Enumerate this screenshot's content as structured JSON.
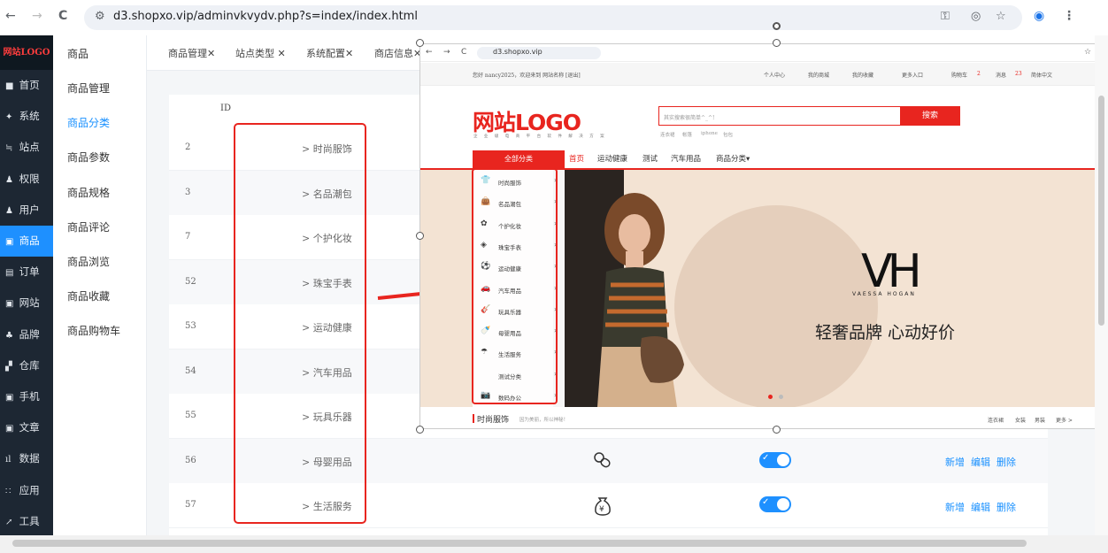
{
  "browser": {
    "url": "d3.shopxo.vip/adminvkvydv.php?s=index/index.html",
    "back_icon": "←",
    "forward_icon": "→",
    "reload_icon": "C"
  },
  "sidebar": {
    "logo": "网站LOGO",
    "items": [
      {
        "icon": "■",
        "label": "首页"
      },
      {
        "icon": "✦",
        "label": "系统"
      },
      {
        "icon": "≒",
        "label": "站点"
      },
      {
        "icon": "♟",
        "label": "权限"
      },
      {
        "icon": "♟",
        "label": "用户"
      },
      {
        "icon": "▣",
        "label": "商品"
      },
      {
        "icon": "▤",
        "label": "订单"
      },
      {
        "icon": "▣",
        "label": "网站"
      },
      {
        "icon": "♣",
        "label": "品牌"
      },
      {
        "icon": "▞",
        "label": "仓库"
      },
      {
        "icon": "▣",
        "label": "手机"
      },
      {
        "icon": "▣",
        "label": "文章"
      },
      {
        "icon": "ıl",
        "label": "数据"
      },
      {
        "icon": "∷",
        "label": "应用"
      },
      {
        "icon": "↗",
        "label": "工具"
      }
    ]
  },
  "subnav": {
    "title": "商品",
    "items": [
      "商品管理",
      "商品分类",
      "商品参数",
      "商品规格",
      "商品评论",
      "商品浏览",
      "商品收藏",
      "商品购物车"
    ]
  },
  "tabs": [
    "商品管理✕",
    "站点类型 ✕",
    "系统配置✕",
    "商店信息✕"
  ],
  "table": {
    "id_header": "ID",
    "rows": [
      {
        "id": "2",
        "name": "> 时尚服饰"
      },
      {
        "id": "3",
        "name": "> 名品潮包"
      },
      {
        "id": "7",
        "name": "> 个护化妆"
      },
      {
        "id": "52",
        "name": "> 珠宝手表"
      },
      {
        "id": "53",
        "name": "> 运动健康"
      },
      {
        "id": "54",
        "name": "> 汽车用品"
      },
      {
        "id": "55",
        "name": "> 玩具乐器"
      },
      {
        "id": "56",
        "name": "> 母婴用品"
      },
      {
        "id": "57",
        "name": "> 生活服务"
      }
    ],
    "actions": {
      "add": "新增",
      "edit": "编辑",
      "delete": "删除"
    }
  },
  "overlay": {
    "url": "d3.shopxo.vip",
    "welcome": "您好 nancy2025，欢迎来到 网站名称 [退出]",
    "top_links": [
      "个人中心",
      "我的商城",
      "我的收藏",
      "更多入口",
      "购物车",
      "2",
      "消息",
      "23",
      "简体中文"
    ],
    "logo": "网站LOGO",
    "slogan": "企 业 级 电 商 平 台 软 件 解 决 方 案",
    "search_placeholder": "其实搜索很简单^_^!",
    "search_button": "搜索",
    "hot_words": [
      "连衣裙",
      "帐篷",
      "iphone",
      "包包"
    ],
    "all_categories": "全部分类",
    "nav": [
      "首页",
      "运动健康",
      "测试",
      "汽车用品",
      "商品分类▾"
    ],
    "categories": [
      {
        "icon": "👕",
        "label": "时尚服饰"
      },
      {
        "icon": "👜",
        "label": "名品潮包"
      },
      {
        "icon": "✿",
        "label": "个护化妆"
      },
      {
        "icon": "◈",
        "label": "珠宝手表"
      },
      {
        "icon": "⚽",
        "label": "运动健康"
      },
      {
        "icon": "🚗",
        "label": "汽车用品"
      },
      {
        "icon": "🎸",
        "label": "玩具乐器"
      },
      {
        "icon": "🍼",
        "label": "母婴用品"
      },
      {
        "icon": "☂",
        "label": "生活服务"
      },
      {
        "icon": "",
        "label": "测试分类"
      },
      {
        "icon": "📷",
        "label": "数码办公"
      }
    ],
    "banner_mark": "VH",
    "banner_brand": "VAESSA HOGAN",
    "banner_slogan": "轻奢品牌 心动好价",
    "floor_title": "时尚服饰",
    "floor_subtitle": "因为美丽，所以神秘！",
    "floor_links": [
      "连衣裙",
      "女装",
      "男装",
      "更多 >"
    ]
  },
  "colors": {
    "accent": "#1e90ff",
    "brand_red": "#e8251f",
    "sidebar_bg": "#1d2733"
  }
}
